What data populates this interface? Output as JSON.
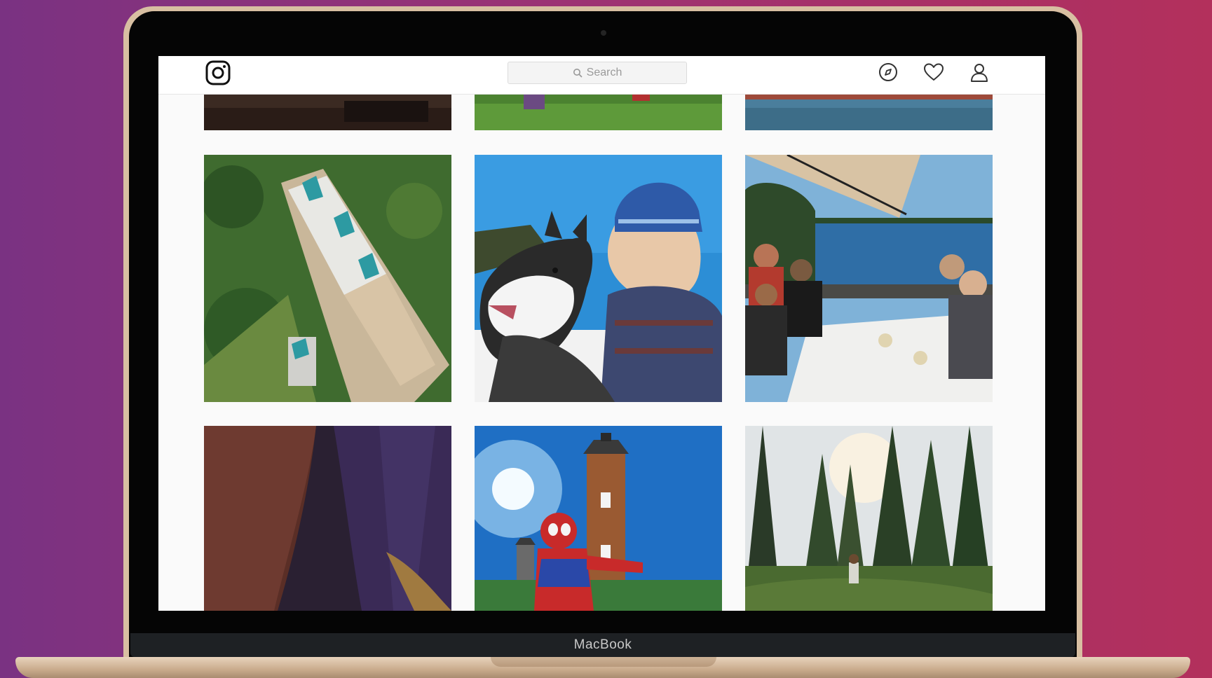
{
  "device": {
    "brand_label": "MacBook"
  },
  "app": {
    "search": {
      "placeholder": "Search"
    },
    "icons": {
      "logo": "instagram-logo-icon",
      "explore": "compass-icon",
      "activity": "heart-icon",
      "profile": "profile-icon",
      "search": "search-icon"
    }
  },
  "feed": {
    "tiles": [
      {
        "label": "cropped-dark-photo"
      },
      {
        "label": "cropped-grass-photo"
      },
      {
        "label": "cropped-water-photo"
      },
      {
        "label": "aerial-castle-photo"
      },
      {
        "label": "husky-and-child-photo"
      },
      {
        "label": "lakeside-dinner-photo"
      },
      {
        "label": "abstract-closeup-photo"
      },
      {
        "label": "lighthouse-costume-photo"
      },
      {
        "label": "forest-hiker-photo"
      }
    ]
  },
  "colors": {
    "background_left": "#7a3282",
    "background_right": "#b3305c",
    "laptop_gold": "#d8bfa2",
    "screen_bg": "#fafafa"
  }
}
